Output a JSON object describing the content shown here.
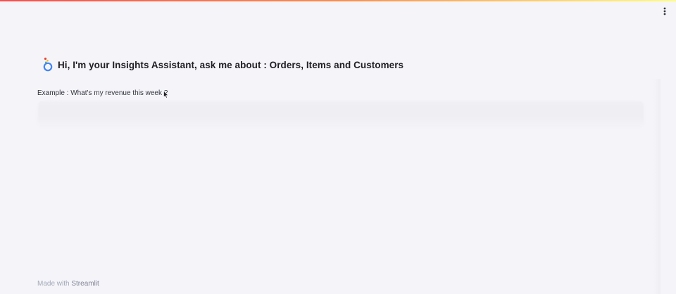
{
  "header": {
    "menu_icon": "more-vertical-icon",
    "decoration_colors": [
      "#ff4b4b",
      "#ff8c4b",
      "#fffd80"
    ]
  },
  "main": {
    "logo_icon": "looker-logo-icon",
    "title": "Hi, I'm your Insights Assistant, ask me about : Orders, Items and Customers",
    "example": "Example : What's my revenue this week ?"
  },
  "footer": {
    "prefix": "Made with",
    "brand": "Streamlit"
  }
}
